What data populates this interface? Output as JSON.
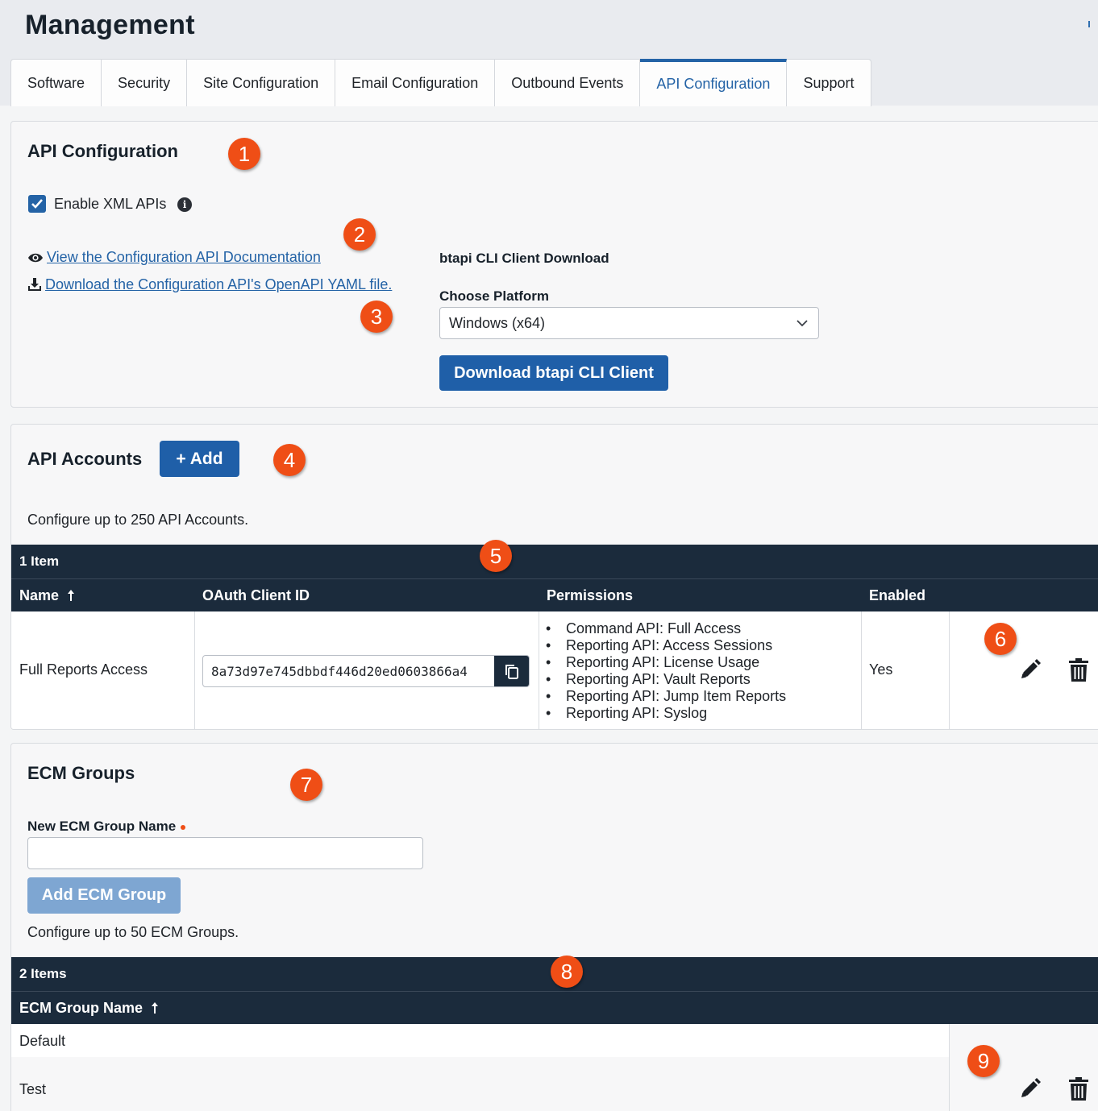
{
  "page": {
    "title": "Management"
  },
  "tabs": [
    {
      "label": "Software"
    },
    {
      "label": "Security"
    },
    {
      "label": "Site Configuration"
    },
    {
      "label": "Email Configuration"
    },
    {
      "label": "Outbound Events"
    },
    {
      "label": "API Configuration",
      "active": true
    },
    {
      "label": "Support"
    }
  ],
  "api_config": {
    "title": "API Configuration",
    "enable_xml_label": "Enable XML APIs",
    "enable_xml_checked": true,
    "doc_link": "View the Configuration API Documentation",
    "yaml_link": "Download the Configuration API's OpenAPI YAML file.",
    "cli_heading": "btapi CLI Client Download",
    "platform_label": "Choose Platform",
    "platform_value": "Windows (x64)",
    "download_button": "Download btapi CLI Client"
  },
  "api_accounts": {
    "title": "API Accounts",
    "add_button": "+ Add",
    "description": "Configure up to 250 API Accounts.",
    "item_count": "1 Item",
    "columns": [
      "Name",
      "OAuth Client ID",
      "Permissions",
      "Enabled"
    ],
    "rows": [
      {
        "name": "Full Reports Access",
        "client_id": "8a73d97e745dbbdf446d20ed0603866a4",
        "permissions": [
          "Command API: Full Access",
          "Reporting API: Access Sessions",
          "Reporting API: License Usage",
          "Reporting API: Vault Reports",
          "Reporting API: Jump Item Reports",
          "Reporting API: Syslog"
        ],
        "enabled": "Yes"
      }
    ]
  },
  "ecm_groups": {
    "title": "ECM Groups",
    "new_group_label": "New ECM Group Name",
    "add_button": "Add ECM Group",
    "description": "Configure up to 50 ECM Groups.",
    "item_count": "2 Items",
    "column": "ECM Group Name",
    "rows": [
      {
        "name": "Default"
      },
      {
        "name": "Test"
      }
    ]
  },
  "badges": [
    "1",
    "2",
    "3",
    "4",
    "5",
    "6",
    "7",
    "8",
    "9"
  ],
  "colors": {
    "accent": "#2463a6",
    "badge": "#ef4e16",
    "table_header": "#1b2b3c"
  }
}
